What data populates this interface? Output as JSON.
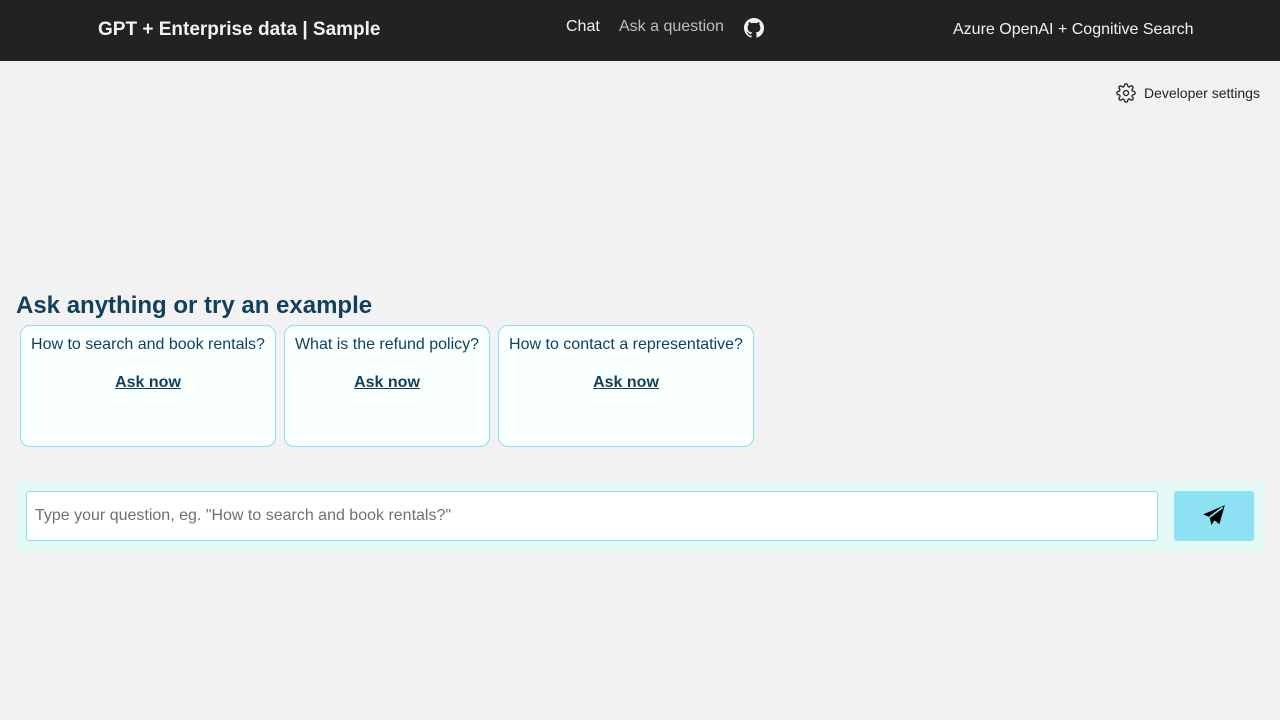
{
  "header": {
    "title": "GPT + Enterprise data | Sample",
    "nav": {
      "chat": "Chat",
      "ask": "Ask a question"
    },
    "right_title": "Azure OpenAI + Cognitive Search"
  },
  "dev_settings": "Developer settings",
  "main": {
    "heading": "Ask anything or try an example",
    "examples": [
      {
        "question": "How to search and book rentals?",
        "action": "Ask now"
      },
      {
        "question": "What is the refund policy?",
        "action": "Ask now"
      },
      {
        "question": "How to contact a representative?",
        "action": "Ask now"
      }
    ]
  },
  "input": {
    "placeholder": "Type your question, eg. \"How to search and book rentals?\"",
    "value": ""
  }
}
